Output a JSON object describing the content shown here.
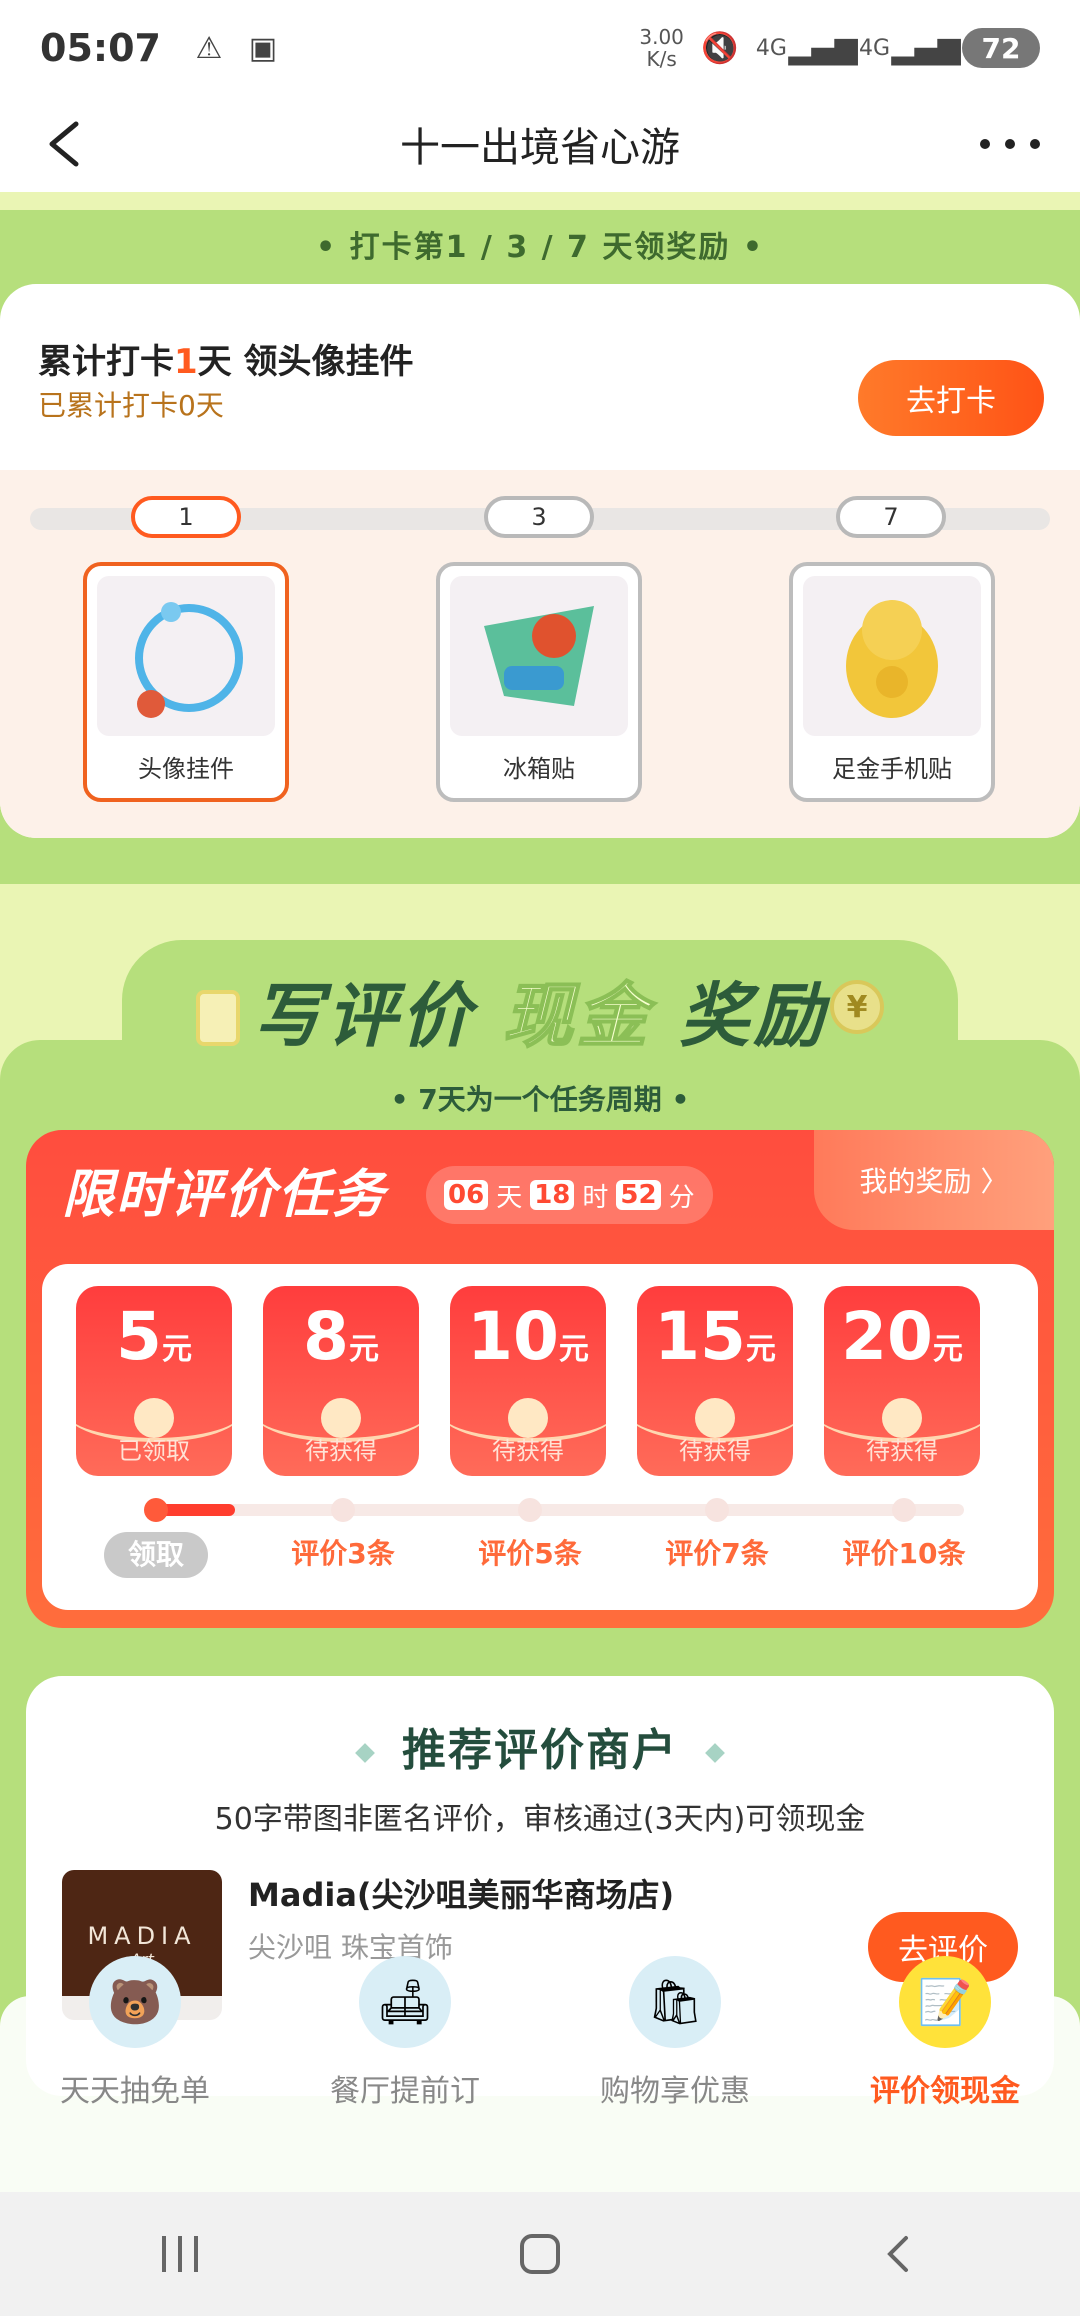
{
  "status_bar": {
    "time": "05:07",
    "speed": "3.00\nK/s",
    "net1": "4G",
    "net2": "4G",
    "battery": "72"
  },
  "header": {
    "title": "十一出境省心游"
  },
  "checkin": {
    "rule": "• 打卡第1 / 3 / 7 天领奖励 •",
    "title_pre": "累计打卡",
    "title_num": "1",
    "title_post": "天 领头像挂件",
    "subtitle": "已累计打卡0天",
    "button": "去打卡",
    "days": [
      "1",
      "3",
      "7"
    ],
    "rewards": [
      {
        "label": "头像挂件",
        "icon": "avatar-frame-icon"
      },
      {
        "label": "冰箱贴",
        "icon": "fridge-magnet-icon"
      },
      {
        "label": "足金手机贴",
        "icon": "gold-cat-sticker-icon"
      }
    ]
  },
  "review_section": {
    "title_a": "写评价",
    "title_b": "现金",
    "title_c": "奖励",
    "cycle": "• 7天为一个任务周期 •"
  },
  "task": {
    "title": "限时评价任务",
    "timer": {
      "days": "06",
      "days_unit": "天",
      "hours": "18",
      "hours_unit": "时",
      "minutes": "52",
      "minutes_unit": "分"
    },
    "my_reward": "我的奖励 〉",
    "envelopes": [
      {
        "amount": "5",
        "unit": "元",
        "status": "已领取"
      },
      {
        "amount": "8",
        "unit": "元",
        "status": "待获得"
      },
      {
        "amount": "10",
        "unit": "元",
        "status": "待获得"
      },
      {
        "amount": "15",
        "unit": "元",
        "status": "待获得"
      },
      {
        "amount": "20",
        "unit": "元",
        "status": "待获得"
      }
    ],
    "steps": [
      "领取",
      "评价3条",
      "评价5条",
      "评价7条",
      "评价10条"
    ],
    "progress": 0.1
  },
  "merchants": {
    "title": "推荐评价商户",
    "subtitle": "50字带图非匿名评价，审核通过(3天内)可领现金",
    "items": [
      {
        "name": "Madia(尖沙咀美丽华商场店)",
        "meta": "尖沙咀 珠宝首饰",
        "logo": "MADIA",
        "logo_tag": "Art",
        "button": "去评价"
      }
    ]
  },
  "bottom_nav": [
    {
      "label": "天天抽免单",
      "icon": "bear-icon"
    },
    {
      "label": "餐厅提前订",
      "icon": "sofa-icon"
    },
    {
      "label": "购物享优惠",
      "icon": "shopping-bag-icon"
    },
    {
      "label": "评价领现金",
      "icon": "notepad-icon"
    }
  ],
  "colors": {
    "accent": "#ff5a1f",
    "green": "#b6df7c",
    "light_green": "#eaf5b4",
    "red": "#ff4d3e"
  }
}
